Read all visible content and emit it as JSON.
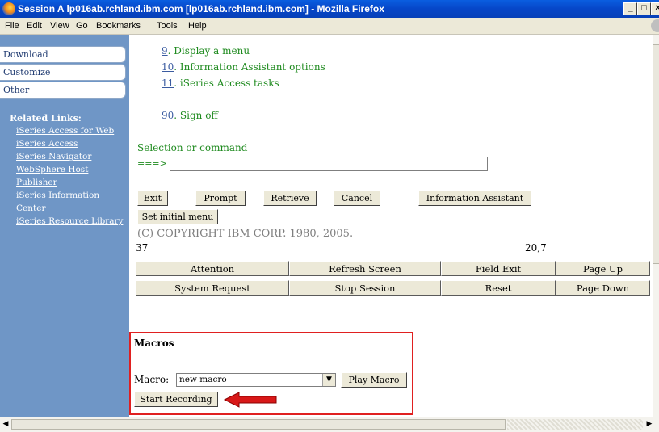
{
  "window": {
    "title": "Session A lp016ab.rchland.ibm.com [lp016ab.rchland.ibm.com] - Mozilla Firefox"
  },
  "menubar": [
    "File",
    "Edit",
    "View",
    "Go",
    "Bookmarks",
    "Tools",
    "Help"
  ],
  "sidebar": {
    "nav": [
      "Download",
      "Customize",
      "Other"
    ],
    "related_heading": "Related Links:",
    "links": [
      "iSeries Access for Web",
      "iSeries Access",
      "iSeries Navigator",
      "WebSphere Host",
      "Publisher",
      "iSeries Information",
      "Center",
      "iSeries Resource Library"
    ]
  },
  "menu_options": [
    {
      "num": "9",
      "text": ". Display a menu"
    },
    {
      "num": "10",
      "text": ". Information Assistant options"
    },
    {
      "num": "11",
      "text": ". iSeries Access tasks"
    },
    {
      "num": "90",
      "text": ". Sign off"
    }
  ],
  "command": {
    "label": "Selection or command",
    "arrow": "===>",
    "value": ""
  },
  "function_keys": [
    "Exit",
    "Prompt",
    "Retrieve",
    "Cancel",
    "Information Assistant",
    "Set initial menu"
  ],
  "copyright": "(C) COPYRIGHT IBM CORP. 1980, 2005.",
  "status": {
    "left": "37",
    "right": "20,7"
  },
  "keypad": {
    "row1": [
      "Attention",
      "Refresh Screen",
      "Field Exit",
      "Page Up"
    ],
    "row2": [
      "System Request",
      "Stop Session",
      "Reset",
      "Page Down"
    ]
  },
  "macros": {
    "heading": "Macros",
    "label": "Macro:",
    "selected": "new macro",
    "play_label": "Play Macro",
    "record_label": "Start Recording"
  },
  "colors": {
    "highlight_box": "#e02020",
    "arrow": "#d81818",
    "sidebar": "#6f96c6",
    "terminal_text": "#1e8a1e"
  }
}
